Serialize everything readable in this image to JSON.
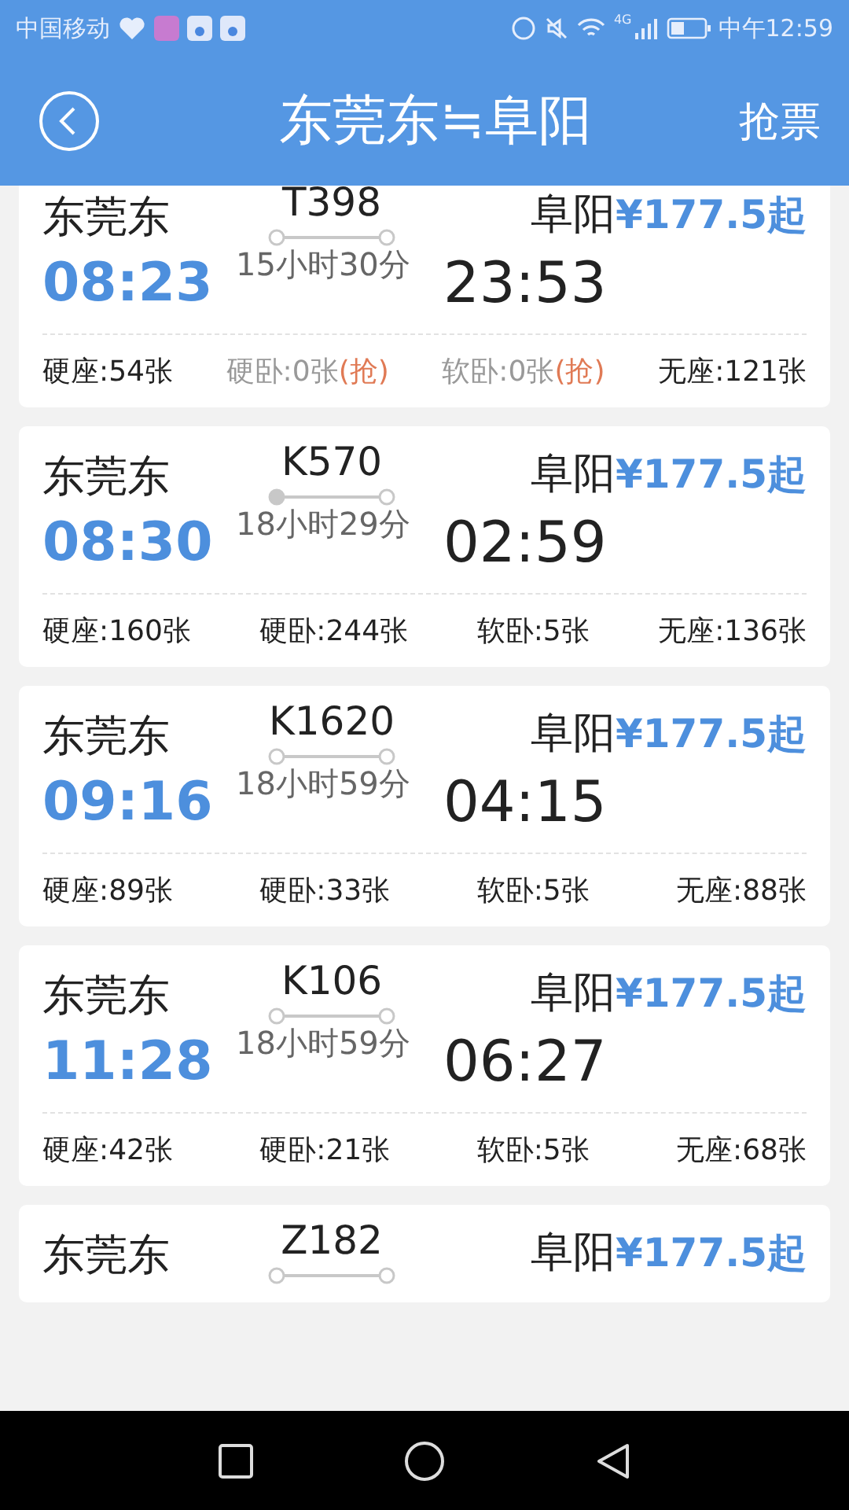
{
  "status_bar": {
    "carrier": "中国移动",
    "network": "4G",
    "time": "中午12:59"
  },
  "header": {
    "title": "东莞东≒阜阳",
    "action": "抢票"
  },
  "trains": [
    {
      "from": "东莞东",
      "number": "T398",
      "to": "阜阳",
      "price": "¥177.5起",
      "depart": "08:23",
      "duration": "15小时30分",
      "arrive": "23:53",
      "origin": false,
      "seats": [
        {
          "text": "硬座:54张",
          "sold_out": false
        },
        {
          "text": "硬卧:0张",
          "sold_out": true,
          "grab": "(抢)"
        },
        {
          "text": "软卧:0张",
          "sold_out": true,
          "grab": "(抢)"
        },
        {
          "text": "无座:121张",
          "sold_out": false
        }
      ]
    },
    {
      "from": "东莞东",
      "number": "K570",
      "to": "阜阳",
      "price": "¥177.5起",
      "depart": "08:30",
      "duration": "18小时29分",
      "arrive": "02:59",
      "origin": true,
      "seats": [
        {
          "text": "硬座:160张",
          "sold_out": false
        },
        {
          "text": "硬卧:244张",
          "sold_out": false
        },
        {
          "text": "软卧:5张",
          "sold_out": false
        },
        {
          "text": "无座:136张",
          "sold_out": false
        }
      ]
    },
    {
      "from": "东莞东",
      "number": "K1620",
      "to": "阜阳",
      "price": "¥177.5起",
      "depart": "09:16",
      "duration": "18小时59分",
      "arrive": "04:15",
      "origin": false,
      "seats": [
        {
          "text": "硬座:89张",
          "sold_out": false
        },
        {
          "text": "硬卧:33张",
          "sold_out": false
        },
        {
          "text": "软卧:5张",
          "sold_out": false
        },
        {
          "text": "无座:88张",
          "sold_out": false
        }
      ]
    },
    {
      "from": "东莞东",
      "number": "K106",
      "to": "阜阳",
      "price": "¥177.5起",
      "depart": "11:28",
      "duration": "18小时59分",
      "arrive": "06:27",
      "origin": false,
      "seats": [
        {
          "text": "硬座:42张",
          "sold_out": false
        },
        {
          "text": "硬卧:21张",
          "sold_out": false
        },
        {
          "text": "软卧:5张",
          "sold_out": false
        },
        {
          "text": "无座:68张",
          "sold_out": false
        }
      ]
    },
    {
      "from": "东莞东",
      "number": "Z182",
      "to": "阜阳",
      "price": "¥177.5起",
      "origin": false
    }
  ]
}
